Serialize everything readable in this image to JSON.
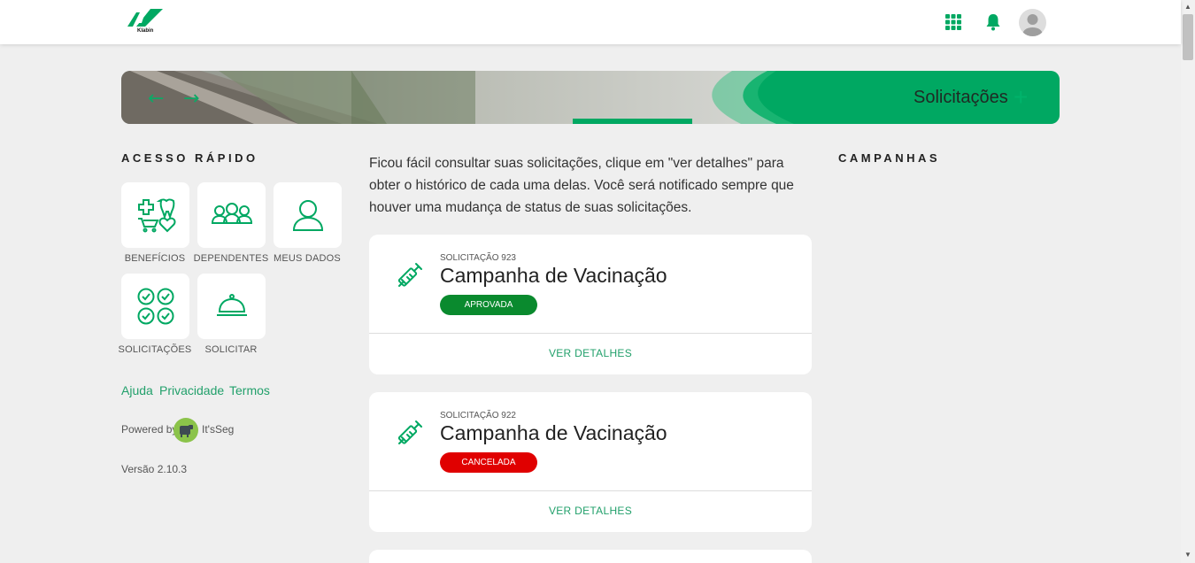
{
  "header": {
    "logo_text": "Klabin",
    "icons": [
      "apps-grid-icon",
      "bell-icon",
      "user-avatar-icon"
    ]
  },
  "banner": {
    "title": "Solicitações",
    "plus_icon": "+"
  },
  "quick_access": {
    "title": "ACESSO RÁPIDO",
    "tiles": [
      {
        "label": "BENEFÍCIOS",
        "icon": "benefits-icon"
      },
      {
        "label": "DEPENDENTES",
        "icon": "dependents-icon"
      },
      {
        "label": "MEUS DADOS",
        "icon": "user-icon"
      },
      {
        "label": "SOLICITAÇÕES",
        "icon": "checks-icon"
      },
      {
        "label": "SOLICITAR",
        "icon": "service-bell-icon"
      }
    ]
  },
  "footer": {
    "links": [
      "Ajuda",
      "Privacidade",
      "Termos"
    ],
    "powered_by": "Powered by",
    "brand": "It'sSeg",
    "version": "Versão 2.10.3"
  },
  "main": {
    "intro": "Ficou fácil consultar suas solicitações, clique em \"ver detalhes\" para obter o histórico de cada uma delas. Você será notificado sempre que houver uma mudança de status de suas solicitações.",
    "requests": [
      {
        "sub": "SOLICITAÇÃO 923",
        "title": "Campanha de Vacinação",
        "status": "APROVADA",
        "status_color": "#0a8a2e",
        "link": "VER DETALHES",
        "icon": "syringe-icon"
      },
      {
        "sub": "SOLICITAÇÃO 922",
        "title": "Campanha de Vacinação",
        "status": "CANCELADA",
        "status_color": "#e00000",
        "link": "VER DETALHES",
        "icon": "syringe-icon"
      }
    ]
  },
  "campaigns": {
    "title": "CAMPANHAS"
  },
  "colors": {
    "accent": "#00a862",
    "link": "#22a06b",
    "background": "#efefef"
  }
}
